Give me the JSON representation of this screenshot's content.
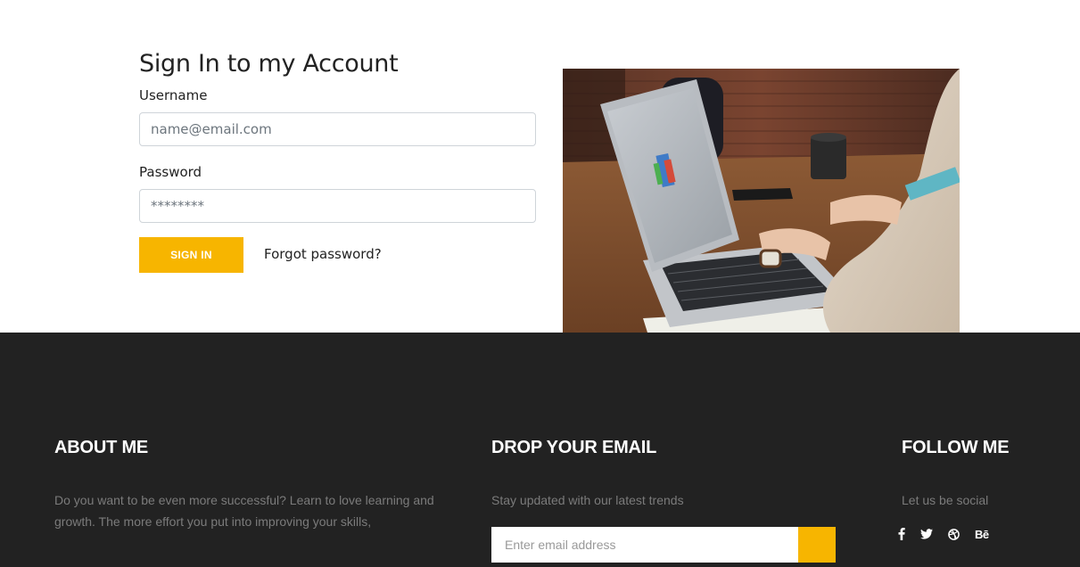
{
  "signin": {
    "title": "Sign In to my Account",
    "username_label": "Username",
    "username_placeholder": "name@email.com",
    "password_label": "Password",
    "password_placeholder": "********",
    "signin_button": "SIGN IN",
    "forgot_link": "Forgot password?"
  },
  "footer": {
    "about": {
      "heading": "ABOUT ME",
      "text": "Do you want to be even more successful? Learn to love learning and growth. The more effort you put into improving your skills,"
    },
    "email": {
      "heading": "DROP YOUR EMAIL",
      "text": "Stay updated with our latest trends",
      "placeholder": "Enter email address"
    },
    "follow": {
      "heading": "FOLLOW ME",
      "text": "Let us be social",
      "icons": [
        "facebook-icon",
        "twitter-icon",
        "dribbble-icon",
        "behance-icon"
      ],
      "behance_glyph": "Bē"
    }
  },
  "colors": {
    "accent": "#f7b500",
    "footer_bg": "#222222",
    "text_dark": "#222222",
    "footer_text": "#7b7b7b"
  }
}
